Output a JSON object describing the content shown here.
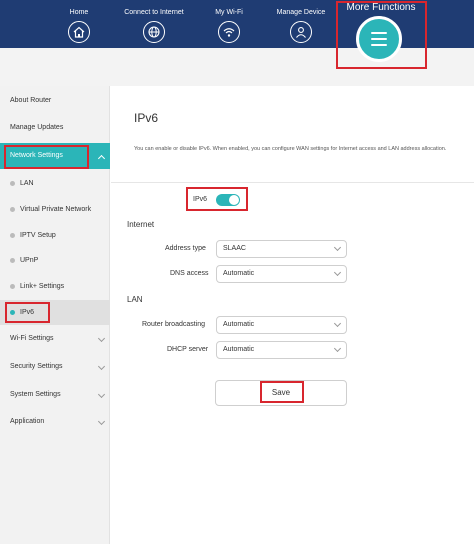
{
  "nav": {
    "items": [
      {
        "label": "Home",
        "icon": "home-icon"
      },
      {
        "label": "Connect to Internet",
        "icon": "globe-icon"
      },
      {
        "label": "My Wi-Fi",
        "icon": "wifi-icon"
      },
      {
        "label": "Manage Device",
        "icon": "user-icon"
      }
    ],
    "more_label": "More Functions",
    "more_icon": "menu-icon",
    "accent_color": "#2bb5b8",
    "bar_color": "#1f3c73"
  },
  "sidebar": {
    "about": "About Router",
    "manage_updates": "Manage Updates",
    "network_settings": "Network Settings",
    "sub_items": [
      "LAN",
      "Virtual Private Network",
      "IPTV Setup",
      "UPnP",
      "Link+ Settings",
      "IPv6"
    ],
    "wifi_settings": "Wi-Fi Settings",
    "security_settings": "Security Settings",
    "system_settings": "System Settings",
    "application": "Application"
  },
  "main": {
    "title": "IPv6",
    "description": "You can enable or disable IPv6. When enabled, you can configure WAN settings for Internet access and LAN address allocation.",
    "toggle_label": "IPv6",
    "toggle_on": true,
    "internet_heading": "Internet",
    "address_type_label": "Address type",
    "address_type_value": "SLAAC",
    "dns_access_label": "DNS access",
    "dns_access_value": "Automatic",
    "lan_heading": "LAN",
    "router_broadcasting_label": "Router broadcasting",
    "router_broadcasting_value": "Automatic",
    "dhcp_server_label": "DHCP server",
    "dhcp_server_value": "Automatic",
    "save_label": "Save"
  },
  "highlight_color": "#d8262e"
}
